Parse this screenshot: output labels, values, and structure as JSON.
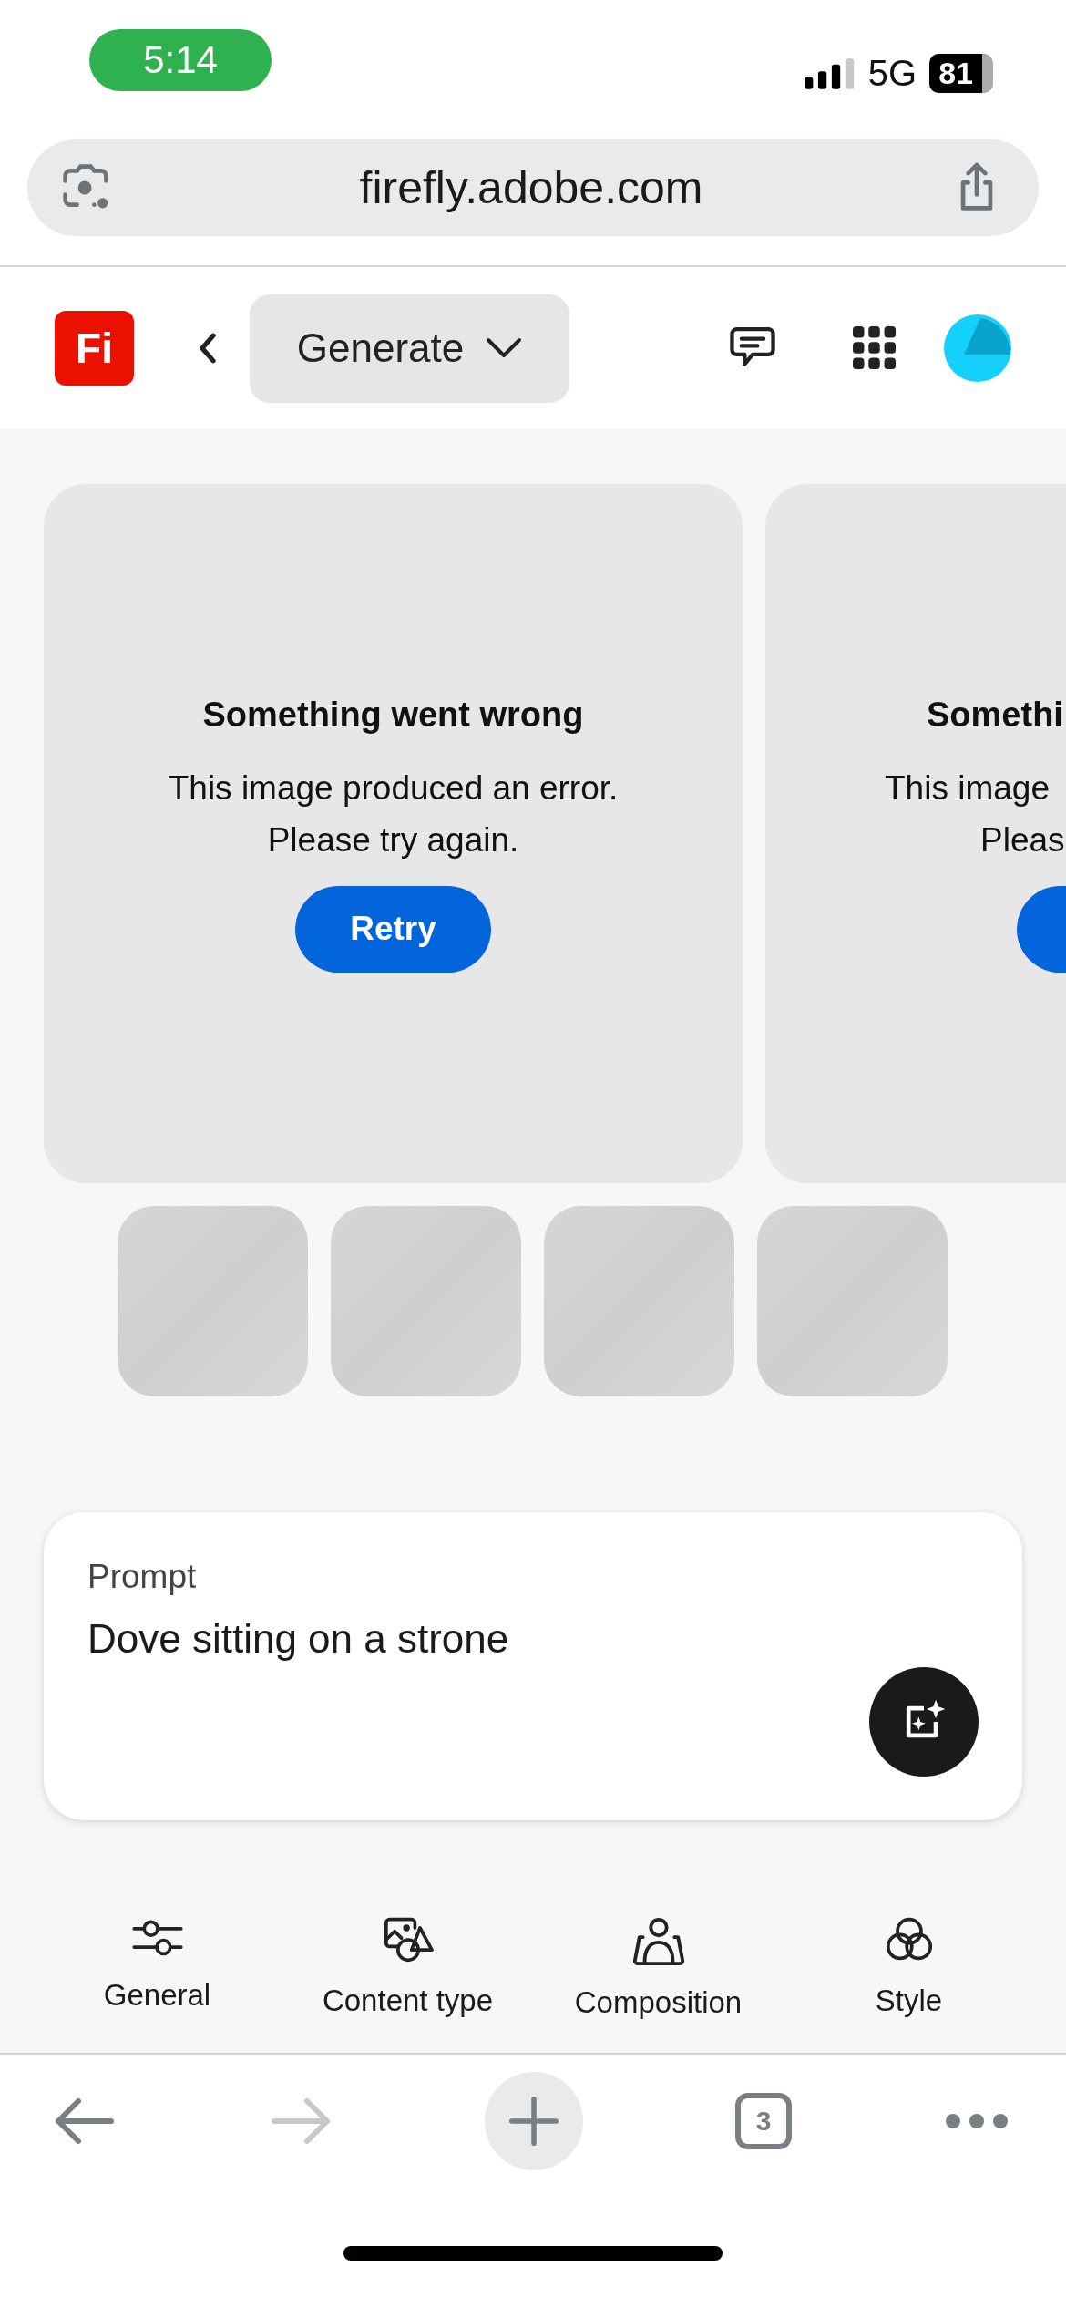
{
  "status_bar": {
    "time": "5:14",
    "network": "5G",
    "battery": "81"
  },
  "browser": {
    "url": "firefly.adobe.com",
    "forward_disabled": true,
    "tab_count": "3"
  },
  "header": {
    "logo": "Fi",
    "menu": "Generate"
  },
  "results": [
    {
      "title": "Something went wrong",
      "message": [
        "This image produced an error.",
        "Please try again."
      ],
      "button": "Retry"
    },
    {
      "title": "Somethi",
      "message": [
        "This image",
        "Pleas"
      ]
    }
  ],
  "prompt": {
    "label": "Prompt",
    "value": "Dove sitting on a strone"
  },
  "tools": [
    {
      "kind": "sliders",
      "label": "General"
    },
    {
      "kind": "shapes",
      "label": "Content type"
    },
    {
      "kind": "person",
      "label": "Composition"
    },
    {
      "kind": "circles",
      "label": "Style"
    }
  ]
}
